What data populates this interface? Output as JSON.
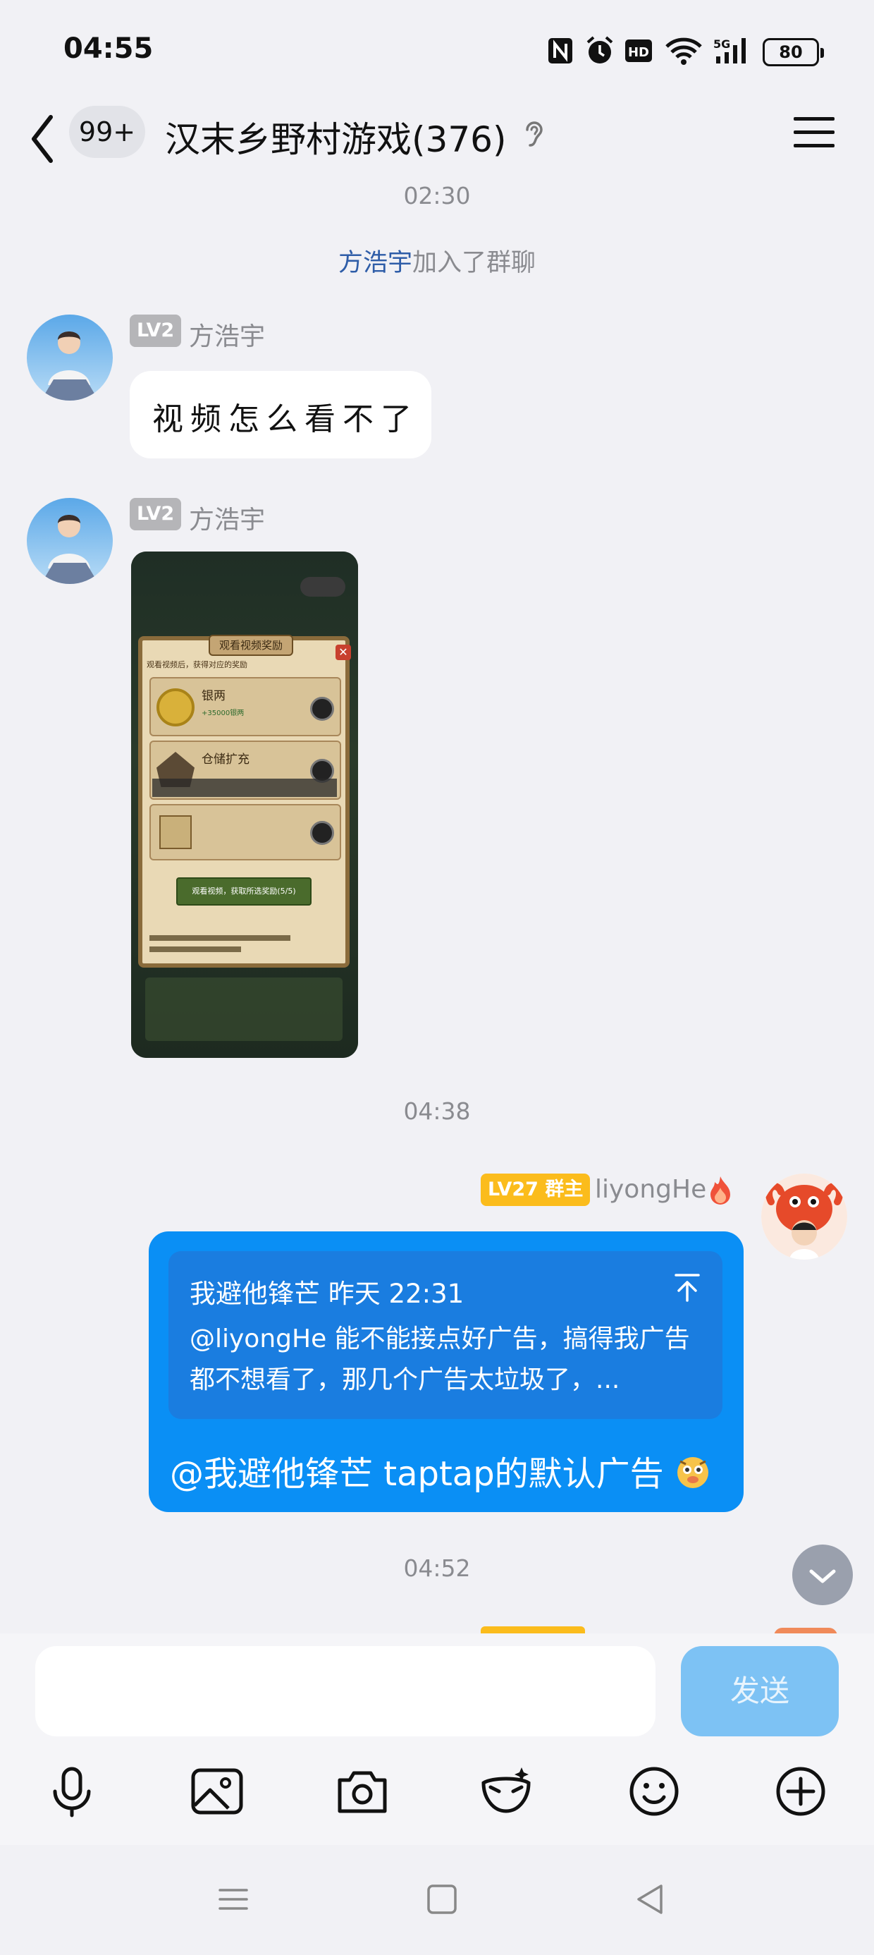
{
  "status_bar": {
    "time": "04:55",
    "battery": "80",
    "network": "5G"
  },
  "header": {
    "unread_badge": "99+",
    "group_title": "汉末乡野村游戏(376)"
  },
  "messages": {
    "ts1": "02:30",
    "join_notice": {
      "name": "方浩宇",
      "text": "加入了群聊"
    },
    "msg1": {
      "level": "LV2",
      "sender": "方浩宇",
      "text": "视频怎么看不了"
    },
    "msg2": {
      "level": "LV2",
      "sender": "方浩宇"
    },
    "ts2": "04:38",
    "msg3": {
      "level": "LV27 群主",
      "sender": "liyongHe",
      "quote_author": "我避他锋芒",
      "quote_time": "昨天 22:31",
      "quote_text": "@liyongHe 能不能接点好广告，搞得我广告都不想看了，那几个广告太垃圾了，...",
      "reply": "@我避他锋芒 taptap的默认广告"
    },
    "ts3": "04:52"
  },
  "screenshot_content": {
    "title": "观看视频奖励",
    "subtitle": "观看视频后，获得对应的奖励",
    "item1": "银两",
    "item1_sub": "+35000银两",
    "item2": "仓储扩充",
    "button": "观看视频，获取所选奖励(5/5)"
  },
  "input": {
    "placeholder": "",
    "send_label": "发送"
  },
  "colors": {
    "accent_blue": "#0a8ff5",
    "send_disabled": "#7dc2f4",
    "owner_badge": "#fbbc1c",
    "level_badge": "#b5b5b8",
    "link_blue": "#2e5da8"
  }
}
